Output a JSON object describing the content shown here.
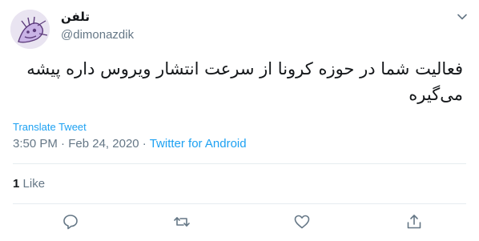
{
  "author": {
    "display_name": "تلفن",
    "handle": "@dimonazdik",
    "avatar": "sketched-creature-avatar"
  },
  "tweet": {
    "text": "فعالیت شما در حوزه کرونا از سرعت انتشار ویروس داره پیشه می‌گیره",
    "translate_label": "Translate Tweet",
    "time": "3:50 PM",
    "separator": "·",
    "date": "Feb 24, 2020",
    "source": "Twitter for Android"
  },
  "stats": {
    "likes_count": "1",
    "likes_label": "Like"
  },
  "icons": {
    "menu": "chevron-down-icon",
    "reply": "reply-icon",
    "retweet": "retweet-icon",
    "like": "heart-icon",
    "share": "share-icon"
  },
  "colors": {
    "link": "#1da1f2",
    "muted": "#657786",
    "text": "#14171a",
    "divider": "#e6ecf0"
  }
}
